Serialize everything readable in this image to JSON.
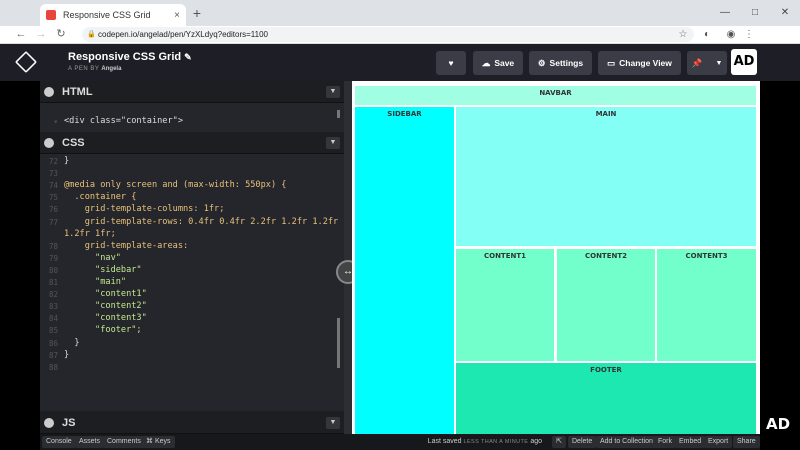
{
  "browser": {
    "tab_title": "Responsive CSS Grid",
    "tab_close": "×",
    "new_tab": "+",
    "url": "codepen.io/angelad/pen/YzXLdyq?editors=1100",
    "window_controls": [
      "—",
      "□",
      "✕"
    ]
  },
  "codepen": {
    "pen_title": "Responsive CSS Grid",
    "byline_prefix": "A PEN BY",
    "author": "Angela",
    "save_label": "Save",
    "settings_label": "Settings",
    "change_view_label": "Change View",
    "avatar_text": "AD"
  },
  "editors": {
    "html_label": "HTML",
    "css_label": "CSS",
    "js_label": "JS",
    "html_line": "<div class=\"container\">",
    "css_lines": [
      {
        "n": "72",
        "text": "}"
      },
      {
        "n": "73",
        "text": ""
      },
      {
        "n": "74",
        "text": "@media only screen and (max-width: 550px) {"
      },
      {
        "n": "75",
        "text": "  .container {"
      },
      {
        "n": "76",
        "text": "    grid-template-columns: 1fr;"
      },
      {
        "n": "77",
        "text": "    grid-template-rows: 0.4fr 0.4fr 2.2fr 1.2fr 1.2fr"
      },
      {
        "n": "",
        "text": "1.2fr 1fr;"
      },
      {
        "n": "78",
        "text": "    grid-template-areas:"
      },
      {
        "n": "79",
        "text": "      \"nav\""
      },
      {
        "n": "80",
        "text": "      \"sidebar\""
      },
      {
        "n": "81",
        "text": "      \"main\""
      },
      {
        "n": "82",
        "text": "      \"content1\""
      },
      {
        "n": "83",
        "text": "      \"content2\""
      },
      {
        "n": "84",
        "text": "      \"content3\""
      },
      {
        "n": "85",
        "text": "      \"footer\";"
      },
      {
        "n": "86",
        "text": "  }"
      },
      {
        "n": "87",
        "text": "}"
      },
      {
        "n": "88",
        "text": ""
      }
    ]
  },
  "preview": {
    "navbar": "NAVBAR",
    "sidebar": "SIDEBAR",
    "main": "MAIN",
    "content1": "CONTENT1",
    "content2": "CONTENT2",
    "content3": "CONTENT3",
    "footer": "FOOTER",
    "colors": {
      "navbar": "#a0ffe3",
      "sidebar": "#00ffff",
      "main": "#84fff6",
      "content": "#73ffcc",
      "footer": "#1de8b2"
    }
  },
  "footer": {
    "console": "Console",
    "assets": "Assets",
    "comments": "Comments",
    "keys": "⌘ Keys",
    "last_saved": "Last saved",
    "last_saved_time": "LESS THAN A MINUTE",
    "last_saved_suffix": "ago",
    "delete": "Delete",
    "add_to_collection": "Add to Collection",
    "fork": "Fork",
    "embed": "Embed",
    "export": "Export",
    "share": "Share"
  },
  "watermark": "AD"
}
